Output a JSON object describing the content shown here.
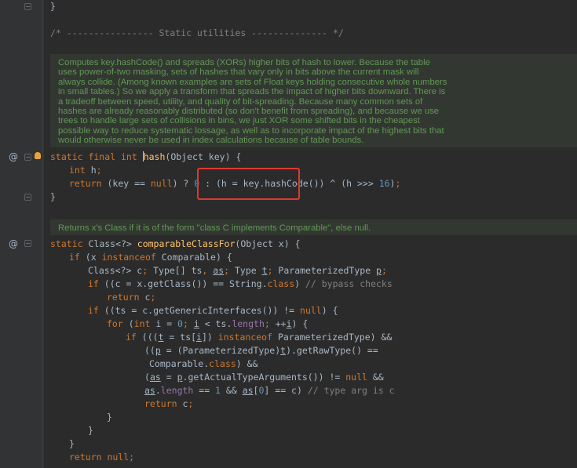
{
  "editor": {
    "section_comment": "/* ---------------- Static utilities -------------- */",
    "doc1": [
      "Computes key.hashCode() and spreads (XORs) higher bits of hash to lower. Because the table",
      "uses power-of-two masking, sets of hashes that vary only in bits above the current mask will",
      "always collide. (Among known examples are sets of Float keys holding consecutive whole numbers",
      "in small tables.) So we apply a transform that spreads the impact of higher bits downward. There is",
      "a tradeoff between speed, utility, and quality of bit-spreading. Because many common sets of",
      "hashes are already reasonably distributed (so don't benefit from spreading), and because we use",
      "trees to handle large sets of collisions in bins, we just XOR some shifted bits in the cheapest",
      "possible way to reduce systematic lossage, as well as to incorporate impact of the highest bits that",
      "would otherwise never be used in index calculations because of table bounds."
    ],
    "doc2": "Returns x's Class if it is of the form \"class C implements Comparable\", else null.",
    "gutter_marker": "@",
    "closing_brace": "}"
  }
}
